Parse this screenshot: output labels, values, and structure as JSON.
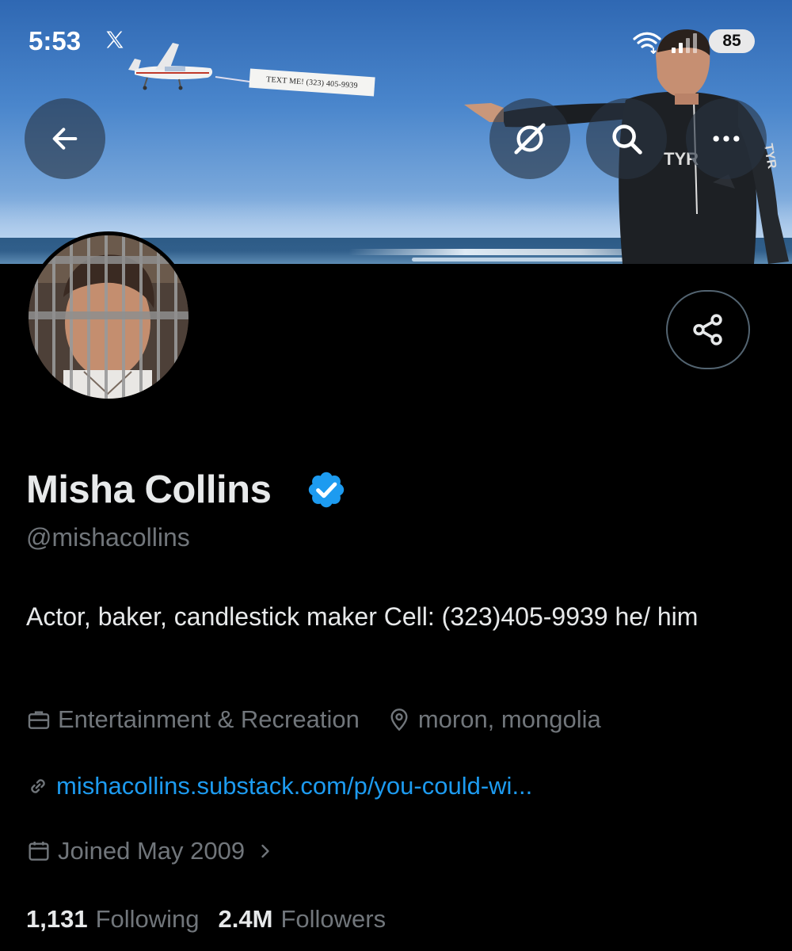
{
  "status_bar": {
    "time": "5:53",
    "battery": "85"
  },
  "banner": {
    "sign_text": "TEXT ME! (323) 405-9939"
  },
  "icons": {
    "back": "arrow-left-icon",
    "grok": "grok-icon",
    "search": "search-icon",
    "more": "more-icon",
    "share": "share-icon",
    "verified": "verified-badge-icon",
    "category": "briefcase-icon",
    "location": "location-pin-icon",
    "link": "link-icon",
    "joined": "calendar-icon"
  },
  "profile": {
    "display_name": "Misha Collins",
    "handle": "@mishacollins",
    "bio": "Actor, baker, candlestick maker Cell: (323)405-9939 he/ him",
    "category": "Entertainment & Recreation",
    "location": "moron, mongolia",
    "link": "mishacollins.substack.com/p/you-could-wi...",
    "joined": "Joined May 2009",
    "following_count": "1,131",
    "following_label": "Following",
    "followers_count": "2.4M",
    "followers_label": "Followers"
  },
  "colors": {
    "background": "#000000",
    "primary_text": "#e7e9ea",
    "secondary_text": "#71767b",
    "link": "#1d9bf0",
    "verified": "#1d9bf0"
  }
}
